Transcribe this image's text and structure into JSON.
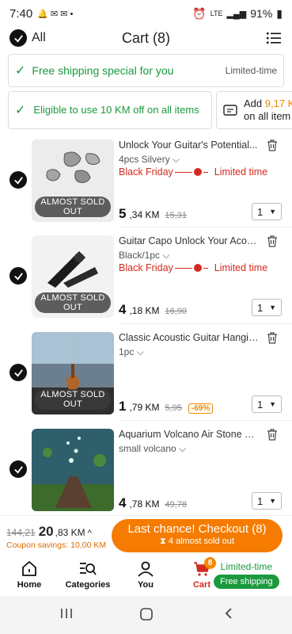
{
  "status_bar": {
    "time": "7:40",
    "network": "LTE",
    "battery": "91%"
  },
  "header": {
    "all_label": "All",
    "title": "Cart (8)"
  },
  "banner": {
    "text": "Free shipping special for you",
    "badge": "Limited-time"
  },
  "promos": [
    {
      "text": "Eligible to use 10 KM off on all items"
    },
    {
      "text_prefix": "Add ",
      "amount": "9,17 K",
      "text_suffix": "on all item"
    }
  ],
  "items": [
    {
      "title": "Unlock Your Guitar's Potential...",
      "variant": "4pcs Silvery",
      "promo": "Black Friday",
      "promo_badge": "Limited time",
      "price_int": "5",
      "price_dec": ",34 KM",
      "price_old": "15,31",
      "discount": "",
      "qty": "1",
      "sold_out": "ALMOST SOLD OUT"
    },
    {
      "title": "Guitar Capo Unlock Your Acous...",
      "variant": "Black/1pc",
      "promo": "Black Friday",
      "promo_badge": "Limited time",
      "price_int": "4",
      "price_dec": ",18 KM",
      "price_old": "16,90",
      "discount": "",
      "qty": "1",
      "sold_out": "ALMOST SOLD OUT"
    },
    {
      "title": "Classic Acoustic Guitar Hangin...",
      "variant": "1pc",
      "promo": "",
      "promo_badge": "",
      "price_int": "1",
      "price_dec": ",79 KM",
      "price_old": "5,95",
      "discount": "-69%",
      "qty": "1",
      "sold_out": "ALMOST SOLD OUT"
    },
    {
      "title": "Aquarium Volcano Air Stone De...",
      "variant": "small volcano",
      "promo": "",
      "promo_badge": "",
      "price_int": "4",
      "price_dec": ",78 KM",
      "price_old": "49,78",
      "discount": "",
      "qty": "1",
      "sold_out": ""
    }
  ],
  "checkout": {
    "old_total": "144,21",
    "total_int": "20",
    "total_dec": ",83 KM",
    "savings": "Coupon savings: 10,00 KM",
    "button_label": "Last chance! Checkout (8)",
    "button_sub": "4 almost sold out"
  },
  "nav": {
    "home": "Home",
    "categories": "Categories",
    "you": "You",
    "cart": "Cart",
    "cart_count": "8",
    "limited": "Limited-time",
    "free_shipping": "Free shipping"
  },
  "colors": {
    "accent": "#f57c00",
    "green": "#1a9a3d",
    "red": "#d32a1e"
  }
}
